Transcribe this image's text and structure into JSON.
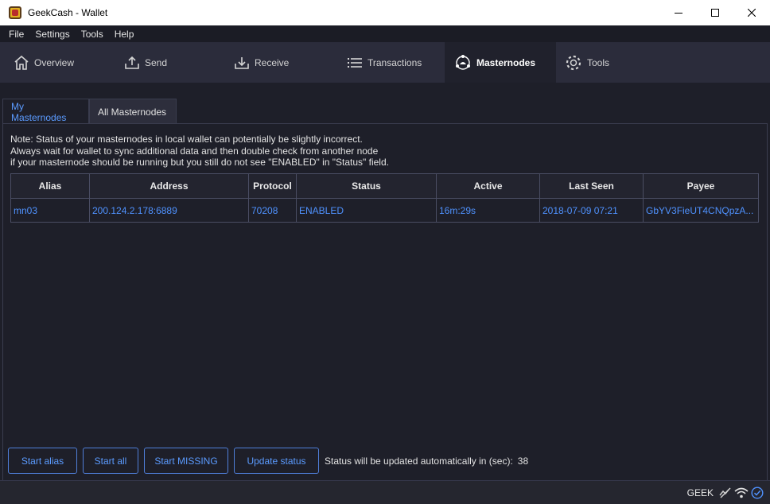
{
  "window": {
    "title": "GeekCash - Wallet"
  },
  "menu": [
    "File",
    "Settings",
    "Tools",
    "Help"
  ],
  "nav": {
    "overview": "Overview",
    "send": "Send",
    "receive": "Receive",
    "transactions": "Transactions",
    "masternodes": "Masternodes",
    "tools": "Tools",
    "active": "Masternodes"
  },
  "subtabs": {
    "my": "My Masternodes",
    "all": "All Masternodes",
    "active": "My Masternodes"
  },
  "note": {
    "line1": "Note: Status of your masternodes in local wallet can potentially be slightly incorrect.",
    "line2": "Always wait for wallet to sync additional data and then double check from another node",
    "line3": "if your masternode should be running but you still do not see \"ENABLED\" in \"Status\" field."
  },
  "table": {
    "columns": [
      "Alias",
      "Address",
      "Protocol",
      "Status",
      "Active",
      "Last Seen",
      "Payee"
    ],
    "rows": [
      [
        "mn03",
        "200.124.2.178:6889",
        "70208",
        "ENABLED",
        "16m:29s",
        "2018-07-09 07:21",
        "GbYV3FieUT4CNQpzA..."
      ]
    ]
  },
  "buttons": {
    "start_alias": "Start alias",
    "start_all": "Start all",
    "start_missing": "Start MISSING",
    "update_status": "Update status"
  },
  "status": {
    "label": "Status will be updated automatically in (sec):",
    "seconds": "38"
  },
  "statusbar": {
    "unit": "GEEK"
  },
  "colors": {
    "accent": "#5b9bff",
    "background": "#1e1f29",
    "nav": "#2b2c3b"
  }
}
